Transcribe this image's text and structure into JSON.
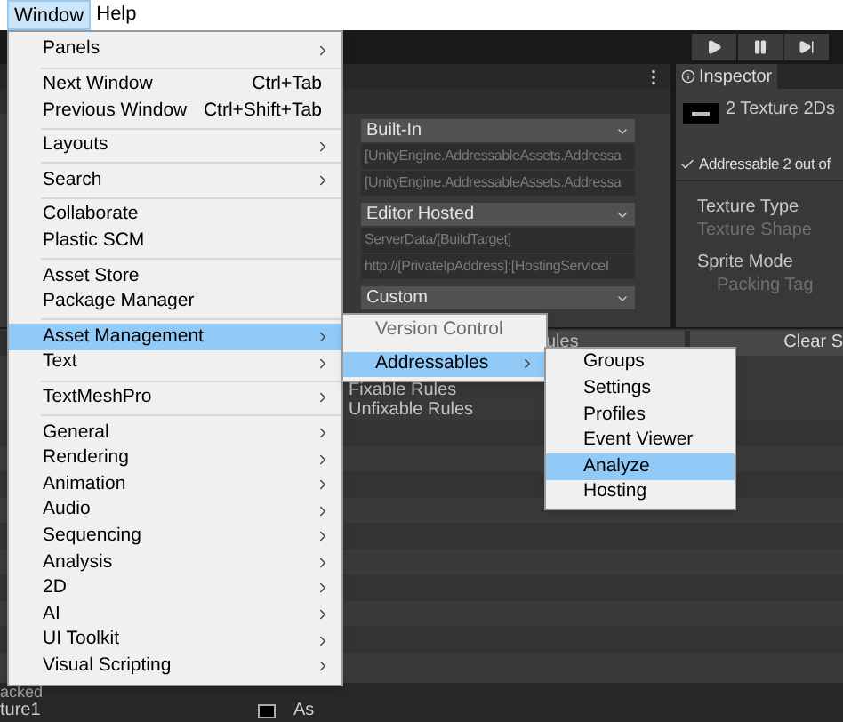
{
  "menu_bar": {
    "items": [
      {
        "label": "Window",
        "selected": true
      },
      {
        "label": "Help",
        "selected": false
      }
    ]
  },
  "window_menu": {
    "items": [
      {
        "kind": "item",
        "label": "Panels",
        "submenu": true,
        "selected": false
      },
      {
        "kind": "separator"
      },
      {
        "kind": "item",
        "label": "Next Window",
        "shortcut": "Ctrl+Tab",
        "submenu": false,
        "selected": false
      },
      {
        "kind": "item",
        "label": "Previous Window",
        "shortcut": "Ctrl+Shift+Tab",
        "submenu": false,
        "selected": false
      },
      {
        "kind": "separator"
      },
      {
        "kind": "item",
        "label": "Layouts",
        "submenu": true,
        "selected": false
      },
      {
        "kind": "separator"
      },
      {
        "kind": "item",
        "label": "Search",
        "submenu": true,
        "selected": false
      },
      {
        "kind": "separator"
      },
      {
        "kind": "item",
        "label": "Collaborate",
        "submenu": false,
        "selected": false
      },
      {
        "kind": "item",
        "label": "Plastic SCM",
        "submenu": false,
        "selected": false
      },
      {
        "kind": "separator"
      },
      {
        "kind": "item",
        "label": "Asset Store",
        "submenu": false,
        "selected": false
      },
      {
        "kind": "item",
        "label": "Package Manager",
        "submenu": false,
        "selected": false
      },
      {
        "kind": "separator"
      },
      {
        "kind": "item",
        "label": "Asset Management",
        "submenu": true,
        "selected": true
      },
      {
        "kind": "item",
        "label": "Text",
        "submenu": true,
        "selected": false
      },
      {
        "kind": "separator"
      },
      {
        "kind": "item",
        "label": "TextMeshPro",
        "submenu": true,
        "selected": false
      },
      {
        "kind": "separator"
      },
      {
        "kind": "item",
        "label": "General",
        "submenu": true,
        "selected": false
      },
      {
        "kind": "item",
        "label": "Rendering",
        "submenu": true,
        "selected": false
      },
      {
        "kind": "item",
        "label": "Animation",
        "submenu": true,
        "selected": false
      },
      {
        "kind": "item",
        "label": "Audio",
        "submenu": true,
        "selected": false
      },
      {
        "kind": "item",
        "label": "Sequencing",
        "submenu": true,
        "selected": false
      },
      {
        "kind": "item",
        "label": "Analysis",
        "submenu": true,
        "selected": false
      },
      {
        "kind": "item",
        "label": "2D",
        "submenu": true,
        "selected": false
      },
      {
        "kind": "item",
        "label": "AI",
        "submenu": true,
        "selected": false
      },
      {
        "kind": "item",
        "label": "UI Toolkit",
        "submenu": true,
        "selected": false
      },
      {
        "kind": "item",
        "label": "Visual Scripting",
        "submenu": true,
        "selected": false
      }
    ]
  },
  "asset_management_menu": {
    "items": [
      {
        "label": "Version Control",
        "disabled": true,
        "submenu": false,
        "selected": false
      },
      {
        "label": "Addressables",
        "disabled": false,
        "submenu": true,
        "selected": true
      }
    ]
  },
  "addressables_menu": {
    "items": [
      {
        "label": "Groups",
        "selected": false
      },
      {
        "label": "Settings",
        "selected": false
      },
      {
        "label": "Profiles",
        "selected": false
      },
      {
        "label": "Event Viewer",
        "selected": false
      },
      {
        "label": "Analyze",
        "selected": true
      },
      {
        "label": "Hosting",
        "selected": false
      }
    ]
  },
  "settings_panel": {
    "rows": [
      {
        "kind": "dropdown",
        "text": "Built-In"
      },
      {
        "kind": "path",
        "text": "[UnityEngine.AddressableAssets.Addressa"
      },
      {
        "kind": "path",
        "text": "[UnityEngine.AddressableAssets.Addressa"
      },
      {
        "kind": "dropdown",
        "text": "Editor Hosted"
      },
      {
        "kind": "path",
        "text": "ServerData/[BuildTarget]"
      },
      {
        "kind": "path",
        "text": "http://[PrivateIpAddress]:[HostingServiceI"
      },
      {
        "kind": "dropdown",
        "text": "Custom"
      }
    ]
  },
  "inspector": {
    "tab": "Inspector",
    "title": "2 Texture 2Ds",
    "addressable": {
      "label": "Addressable 2 out of",
      "checked": true
    },
    "properties": [
      {
        "label": "Texture Type",
        "disabled": false,
        "indented": false
      },
      {
        "label": "Texture Shape",
        "disabled": true,
        "indented": false
      },
      {
        "label": "Sprite Mode",
        "disabled": false,
        "indented": false
      },
      {
        "label": "Packing Tag",
        "disabled": true,
        "indented": true
      }
    ]
  },
  "analyze_window": {
    "tab": "ules",
    "clear_button": "Clear S",
    "tree": [
      "Fixable Rules",
      "Unfixable Rules"
    ]
  },
  "bottom_panel": {
    "lines": [
      "acked",
      "ture1"
    ],
    "column_2": "As"
  }
}
